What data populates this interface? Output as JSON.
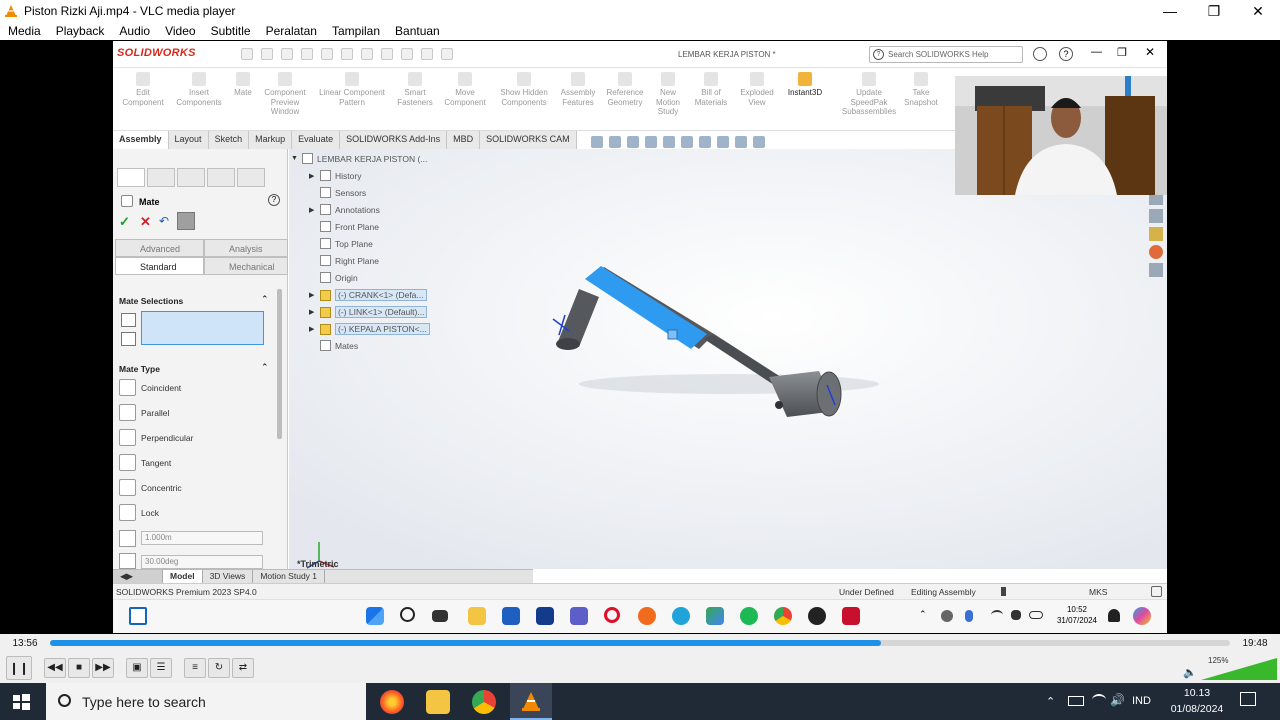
{
  "vlc": {
    "window_title": "Piston Rizki Aji.mp4 - VLC media player",
    "menu": [
      "Media",
      "Playback",
      "Audio",
      "Video",
      "Subtitle",
      "Peralatan",
      "Tampilan",
      "Bantuan"
    ],
    "time_elapsed": "13:56",
    "time_total": "19:48",
    "progress_fraction": 0.704,
    "volume_text": "125%",
    "volume_level_percent": 125
  },
  "solidworks": {
    "logo": "SOLIDWORKS",
    "document_title": "LEMBAR KERJA PISTON *",
    "search_placeholder": "Search SOLIDWORKS Help",
    "command_manager": [
      "Edit Component",
      "Insert Components",
      "Mate",
      "Component Preview Window",
      "Linear Component Pattern",
      "Smart Fasteners",
      "Move Component",
      "Show Hidden Components",
      "Assembly Features",
      "Reference Geometry",
      "New Motion Study",
      "Bill of Materials",
      "Exploded View",
      "Instant3D",
      "Update SpeedPak Subassemblies",
      "Take Snapshot"
    ],
    "tabs": [
      "Assembly",
      "Layout",
      "Sketch",
      "Markup",
      "Evaluate",
      "SOLIDWORKS Add-Ins",
      "MBD",
      "SOLIDWORKS CAM"
    ],
    "active_tab": "Assembly",
    "mate_panel": {
      "title": "Mate",
      "tabs_top": [
        "Advanced",
        "Analysis"
      ],
      "tabs_bottom": [
        "Standard",
        "Mechanical"
      ],
      "mate_selections_label": "Mate Selections",
      "mate_type_label": "Mate Type",
      "mate_types": [
        "Coincident",
        "Parallel",
        "Perpendicular",
        "Tangent",
        "Concentric",
        "Lock"
      ],
      "distance_value": "1.000m",
      "angle_value": "30.00deg"
    },
    "feature_tree": {
      "root": "LEMBAR KERJA PISTON (...",
      "items": [
        {
          "label": "History",
          "expandable": true
        },
        {
          "label": "Sensors",
          "expandable": false
        },
        {
          "label": "Annotations",
          "expandable": true
        },
        {
          "label": "Front Plane",
          "expandable": false
        },
        {
          "label": "Top Plane",
          "expandable": false
        },
        {
          "label": "Right Plane",
          "expandable": false
        },
        {
          "label": "Origin",
          "expandable": false
        },
        {
          "label": "(-) CRANK<1> (Defa...",
          "expandable": true,
          "highlight": true
        },
        {
          "label": "(-) LINK<1> (Default)...",
          "expandable": true,
          "highlight": true
        },
        {
          "label": "(-) KEPALA PISTON<...",
          "expandable": true,
          "highlight": true
        },
        {
          "label": "Mates",
          "expandable": false
        }
      ]
    },
    "view_label": "*Trimetric",
    "bottom_tabs": [
      "Model",
      "3D Views",
      "Motion Study 1"
    ],
    "active_bottom_tab": "Model",
    "status": {
      "product": "SOLIDWORKS Premium 2023 SP4.0",
      "definition": "Under Defined",
      "mode": "Editing Assembly",
      "units": "MKS"
    },
    "inner_clock": {
      "time": "10:52",
      "date": "31/07/2024"
    }
  },
  "windows": {
    "search_placeholder": "Type here to search",
    "language": "IND",
    "time": "10.13",
    "date": "01/08/2024"
  },
  "colors": {
    "vlc_progress": "#1e90e8",
    "link_highlight": "#2e9af0",
    "solidworks_red": "#d52b1e",
    "taskbar": "#202936"
  }
}
